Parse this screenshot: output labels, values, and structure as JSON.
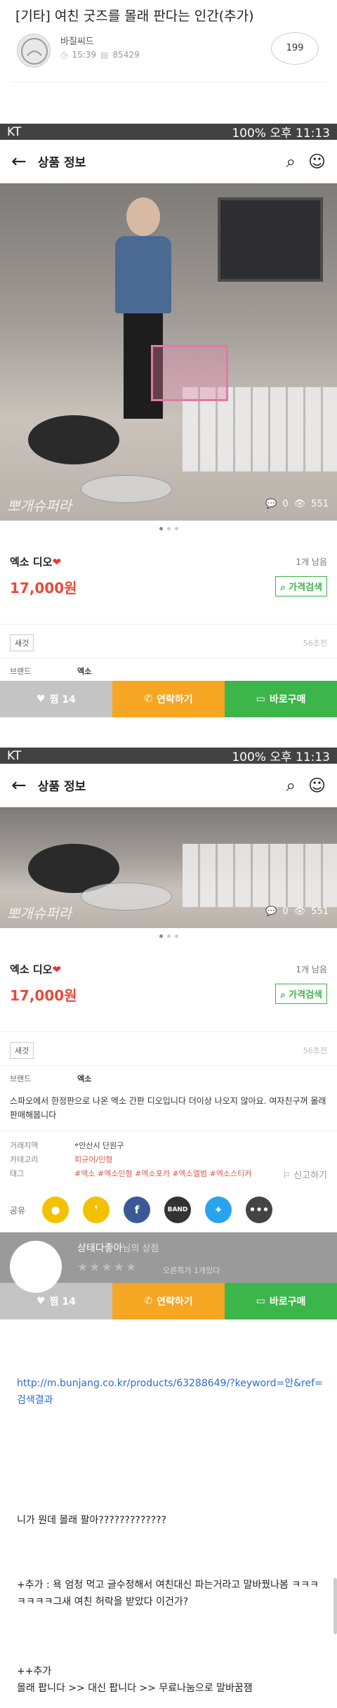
{
  "post": {
    "title": "[기타] 여친 굿즈를 몰래 판다는 인간(추가)",
    "author": "바질씨드",
    "time": "15:39",
    "views": "85429",
    "comments": "199"
  },
  "screen1": {
    "status_left": "KT",
    "status_right": "100% 오후 11:13",
    "appbar_title": "상품 정보",
    "photo_watermark": "뽀개슈퍼라",
    "photo_comments": "0",
    "photo_views": "551",
    "product_name": "엑소 디오",
    "remaining": "1개 남음",
    "price": "17,000원",
    "price_search": "가격검색",
    "tag": "새것",
    "time_ago": "56초전",
    "brand_key": "브랜드",
    "brand_val": "엑소",
    "btn_like": "찜 14",
    "btn_contact": "연락하기",
    "btn_buy": "바로구매"
  },
  "screen2": {
    "status_left": "KT",
    "status_right": "100% 오후 11:13",
    "appbar_title": "상품 정보",
    "photo_watermark": "뽀개슈퍼라",
    "photo_comments": "0",
    "photo_views": "551",
    "product_name": "엑소 디오",
    "remaining": "1개 남음",
    "price": "17,000원",
    "price_search": "가격검색",
    "tag": "새것",
    "time_ago": "56초전",
    "brand_key": "브랜드",
    "brand_val": "엑소",
    "description": "스파오에서 한정판으로 나온 엑소 간판 디오입니다 더이상 나오지 않아요. 여자친구꺼 몰래 판매해봅니다",
    "region_key": "거래지역",
    "region_val": "안산시 단원구",
    "category_key": "카테고리",
    "category_val": "피규어/인형",
    "tags_key": "태그",
    "tags_val": "#엑소 #엑소인형 #엑소포카 #엑소앨범 #엑소스티커",
    "report": "신고하기",
    "share_label": "공유",
    "shop_name": "상태다좋아",
    "shop_suffix": "님의 상점",
    "shop_stars": "★★★★★",
    "shop_count": "오른쪽가 1개있다",
    "btn_like": "찜 14",
    "btn_contact": "연락하기",
    "btn_buy": "바로구매"
  },
  "body": {
    "link": "http://m.bunjang.co.kr/products/63288649/?keyword=안&ref=검색결과",
    "line1": "니가 뭔데 몰래 팔아?????????????",
    "add1": "+추가 : 욕 엄청 먹고 글수정해서 여친대신 파는거라고 말바꿨나봄 ㅋㅋㅋㅋㅋㅋㅋ그새 여친 허락을 받았다 이건가?",
    "add2_title": "++추가",
    "add2": "몰래 팝니다 >> 대신 팝니다 >> 무료나눔으로 말바꿈잼"
  }
}
